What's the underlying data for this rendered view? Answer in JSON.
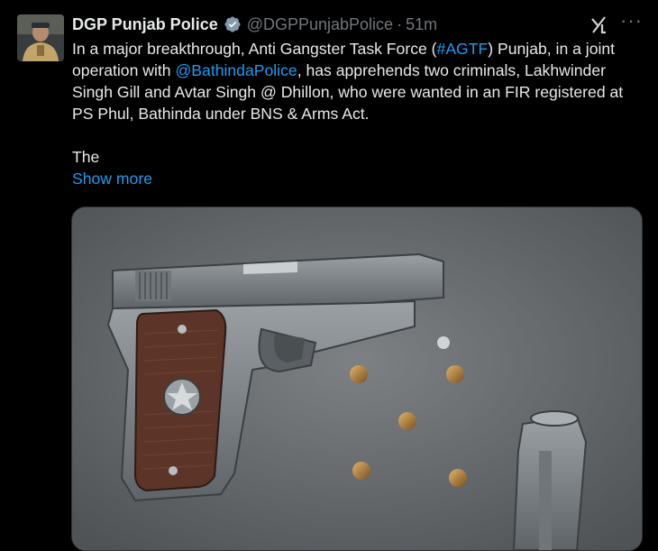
{
  "tweet": {
    "display_name": "DGP Punjab Police",
    "handle": "@DGPPunjabPolice",
    "separator": "·",
    "time": "51m",
    "more_label": "···",
    "text": {
      "line1_a": "In a major breakthrough, Anti Gangster Task Force (",
      "hashtag": "#AGTF",
      "line1_b": ") Punjab, in a joint operation with ",
      "mention": "@BathindaPolice",
      "line1_c": ", has apprehends two criminals, Lakhwinder Singh Gill and Avtar Singh @ Dhillon, who were wanted in an FIR registered at PS Phul, Bathinda under BNS & Arms Act.",
      "line2": "The"
    },
    "show_more": "Show more"
  },
  "icons": {
    "verified": "verified-badge-icon",
    "grok": "grok-icon",
    "more": "more-icon"
  },
  "colors": {
    "background": "#000000",
    "text": "#e7e9ea",
    "secondary": "#71767b",
    "link": "#1d9bf0"
  }
}
